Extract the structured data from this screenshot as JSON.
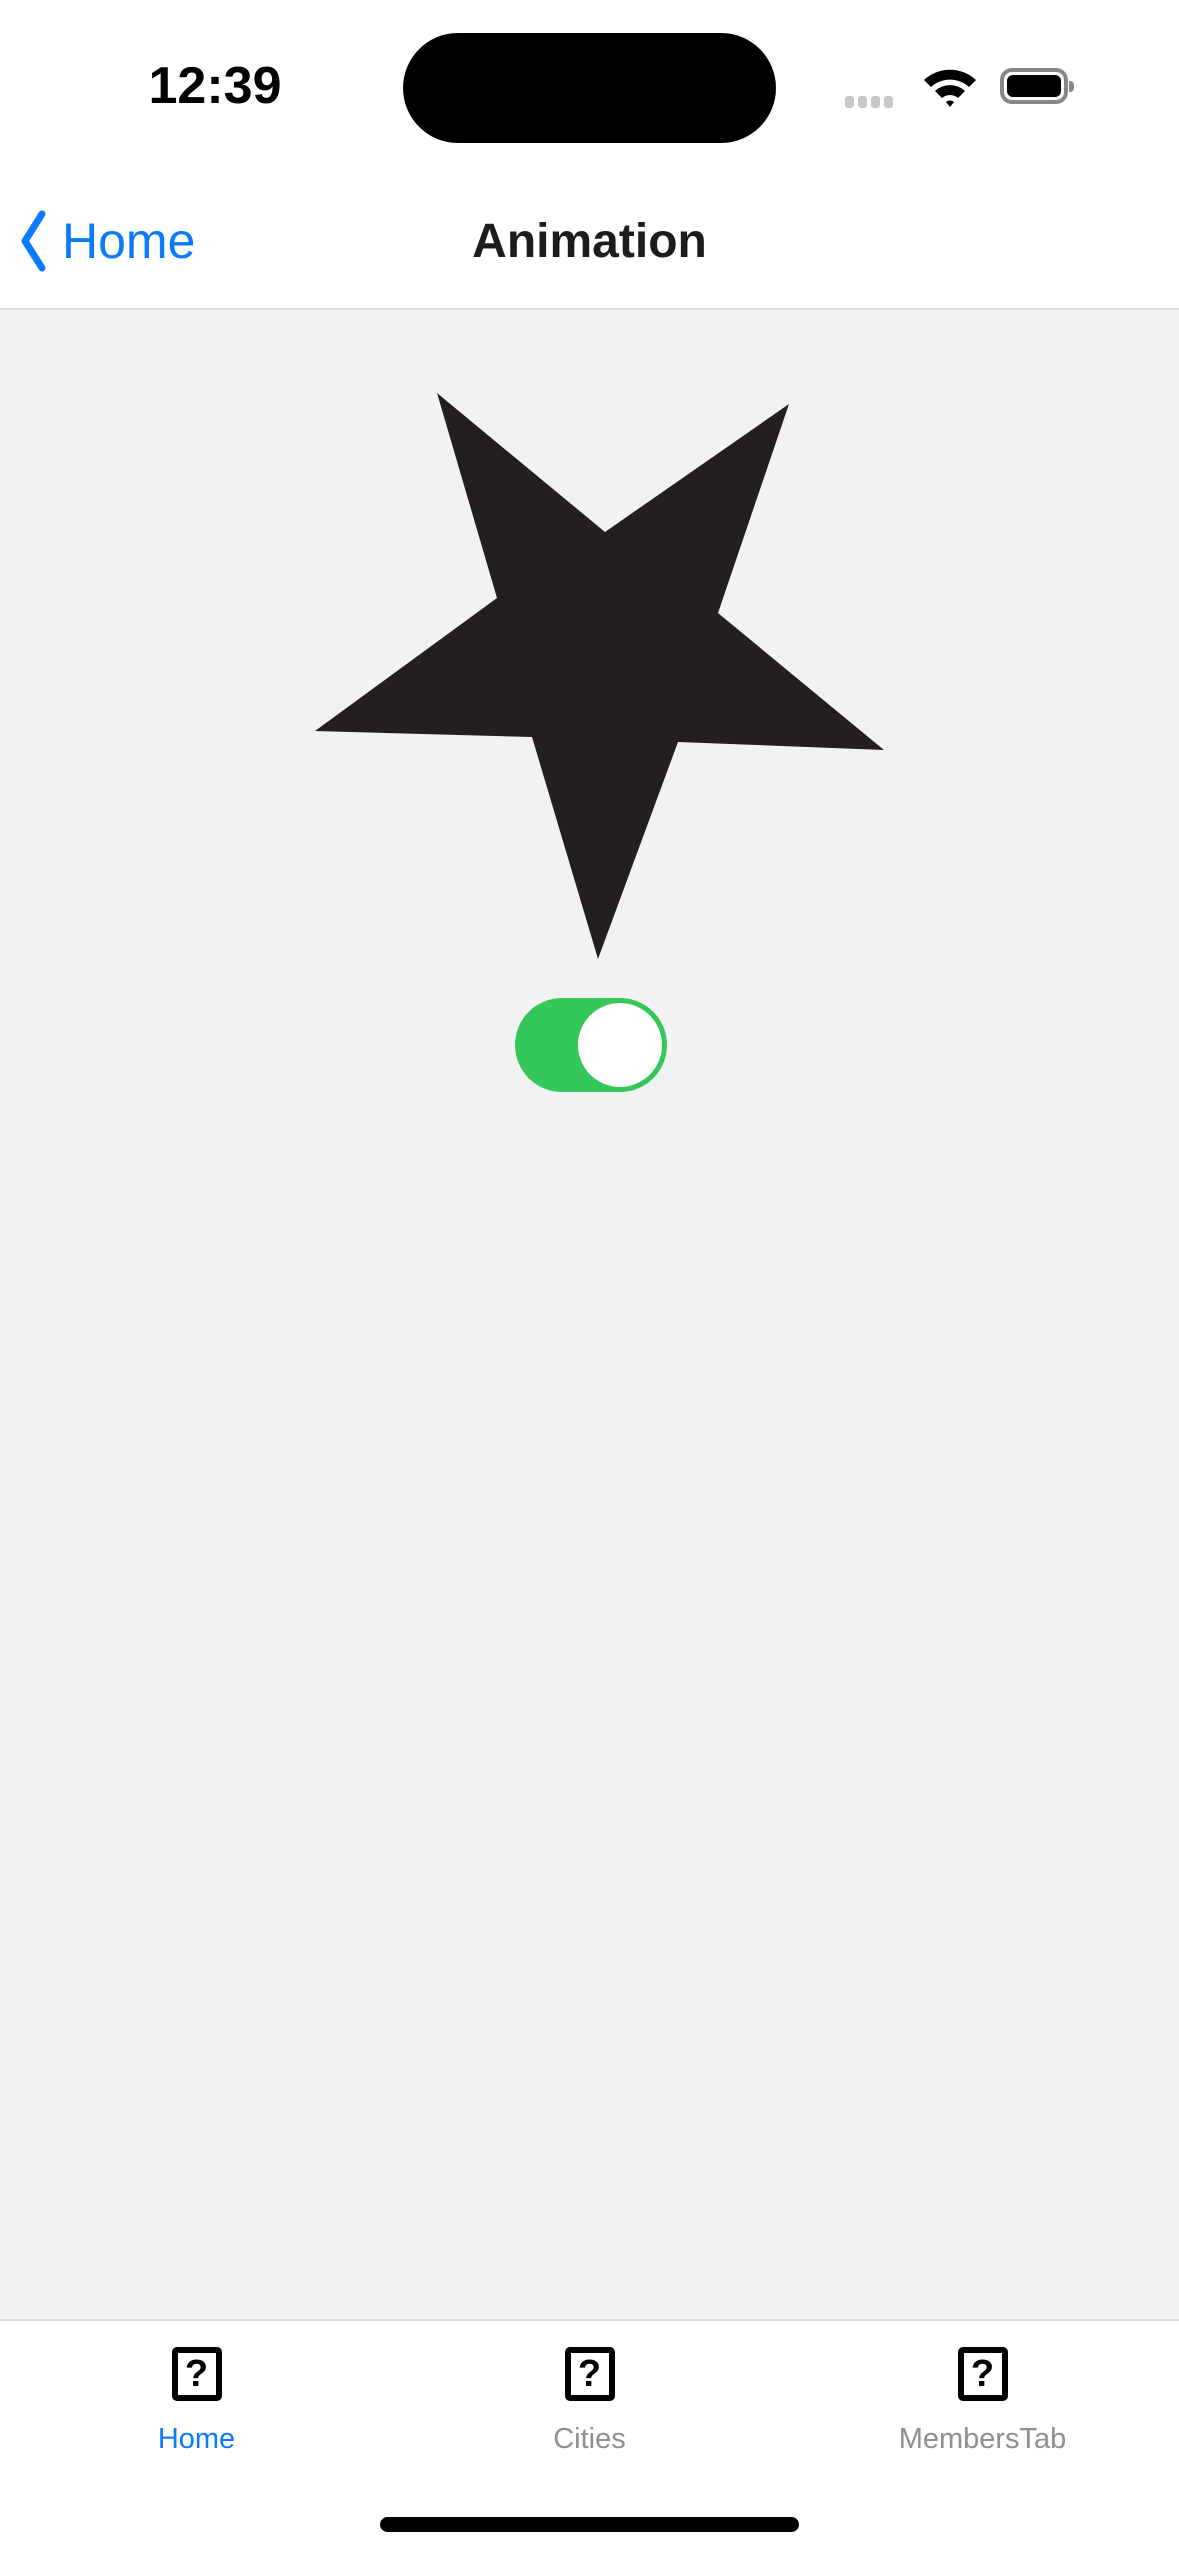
{
  "status_bar": {
    "time": "12:39"
  },
  "nav": {
    "back_label": "Home",
    "title": "Animation"
  },
  "content": {
    "shape": "star",
    "shape_color": "#231f20",
    "toggle_on": true,
    "toggle_color": "#34c759"
  },
  "tabs": [
    {
      "label": "Home",
      "icon": "question-mark-square-icon",
      "active": true
    },
    {
      "label": "Cities",
      "icon": "question-mark-square-icon",
      "active": false
    },
    {
      "label": "MembersTab",
      "icon": "question-mark-square-icon",
      "active": false
    }
  ],
  "colors": {
    "accent": "#0a7aff",
    "inactive": "#8e8e93",
    "background": "#f2f2f2"
  }
}
